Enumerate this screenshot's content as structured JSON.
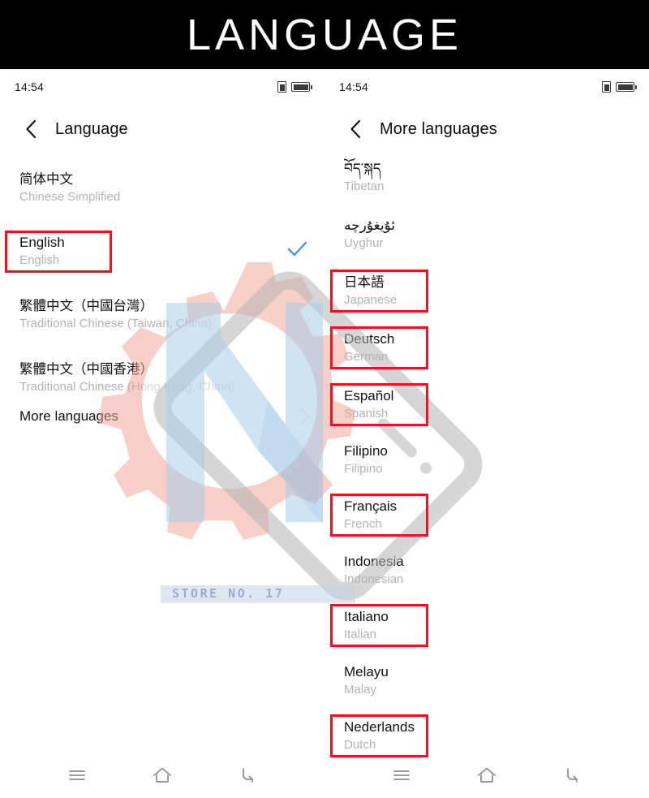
{
  "banner": {
    "title": "LANGUAGE"
  },
  "watermark": {
    "store_text": "STORE NO. 17",
    "gear_color": "#f0a596",
    "letter_color": "#a9cdea",
    "device_color": "#b5b5b5"
  },
  "left_screen": {
    "statusbar": {
      "clock": "14:54",
      "sim_icon": "sim-card-icon",
      "battery_icon": "battery-icon"
    },
    "appbar": {
      "back_icon": "chevron-left-icon",
      "title": "Language"
    },
    "items": [
      {
        "native": "简体中文",
        "english": "Chinese Simplified",
        "cjk": true,
        "checked": false,
        "highlighted": false
      },
      {
        "native": "English",
        "english": "English",
        "cjk": false,
        "checked": true,
        "highlighted": true
      },
      {
        "native": "繁體中文（中國台灣）",
        "english": "Traditional Chinese (Taiwan, China)",
        "cjk": true,
        "checked": false,
        "highlighted": false
      },
      {
        "native": "繁體中文（中國香港）",
        "english": "Traditional Chinese (Hong Kong, China)",
        "cjk": true,
        "checked": false,
        "highlighted": false
      }
    ],
    "more": {
      "label": "More languages",
      "chevron_icon": "chevron-right-icon"
    },
    "navbar": {
      "recents_icon": "recents-menu-icon",
      "home_icon": "home-icon",
      "back_icon": "back-arrow-icon"
    }
  },
  "right_screen": {
    "statusbar": {
      "clock": "14:54",
      "sim_icon": "sim-card-icon",
      "battery_icon": "battery-icon"
    },
    "appbar": {
      "back_icon": "chevron-left-icon",
      "title": "More languages"
    },
    "items": [
      {
        "native": "བོད་སྐད",
        "english": "Tibetan",
        "highlighted": false
      },
      {
        "native": "ئۇيغۇرچە",
        "english": "Uyghur",
        "highlighted": false
      },
      {
        "native": "日本語",
        "english": "Japanese",
        "highlighted": true
      },
      {
        "native": "Deutsch",
        "english": "German",
        "highlighted": true
      },
      {
        "native": "Español",
        "english": "Spanish",
        "highlighted": true
      },
      {
        "native": "Filipino",
        "english": "Filipino",
        "highlighted": false
      },
      {
        "native": "Français",
        "english": "French",
        "highlighted": true
      },
      {
        "native": "Indonesia",
        "english": "Indonesian",
        "highlighted": false
      },
      {
        "native": "Italiano",
        "english": "Italian",
        "highlighted": true
      },
      {
        "native": "Melayu",
        "english": "Malay",
        "highlighted": false
      },
      {
        "native": "Nederlands",
        "english": "Dutch",
        "highlighted": true
      }
    ],
    "navbar": {
      "recents_icon": "recents-menu-icon",
      "home_icon": "home-icon",
      "back_icon": "back-arrow-icon"
    }
  },
  "colors": {
    "highlight": "#fc0d1b",
    "check": "#4a90d9",
    "primary_text": "#111111",
    "secondary_text": "#b3b3b3"
  }
}
